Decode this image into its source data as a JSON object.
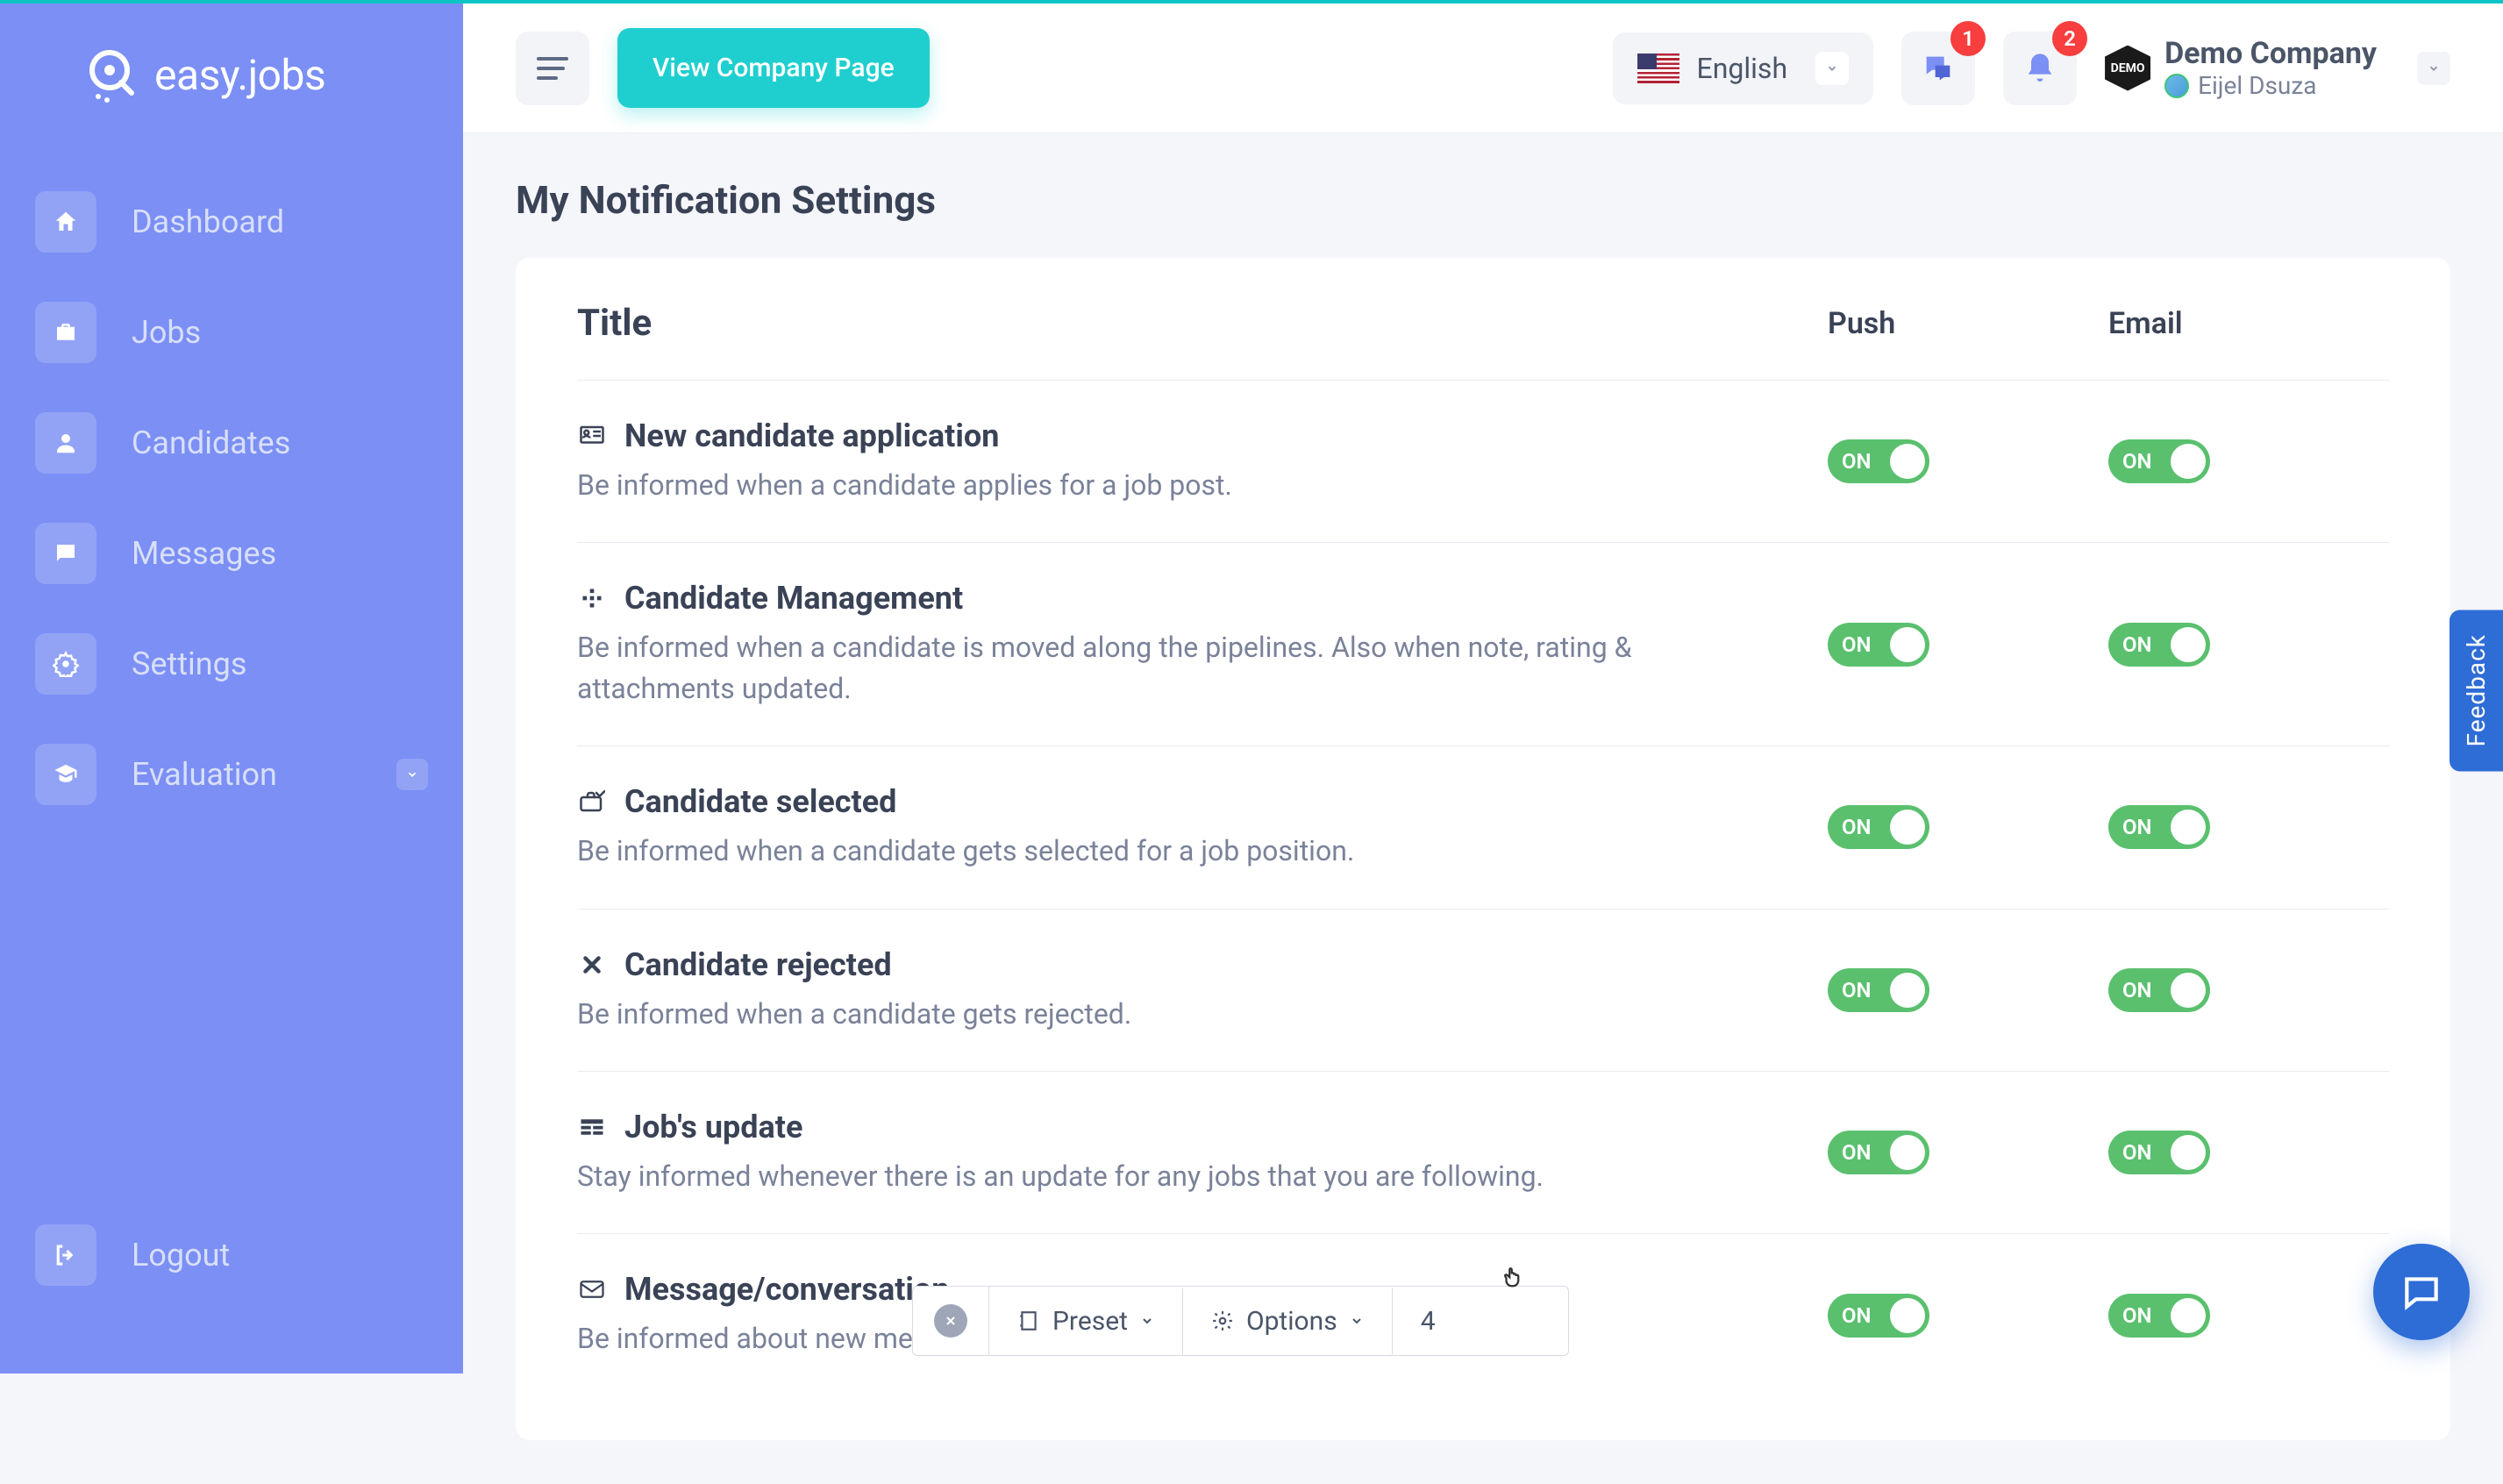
{
  "brand": {
    "name": "easy.jobs"
  },
  "sidebar": {
    "items": [
      {
        "label": "Dashboard",
        "icon": "home-icon"
      },
      {
        "label": "Jobs",
        "icon": "briefcase-icon"
      },
      {
        "label": "Candidates",
        "icon": "user-icon"
      },
      {
        "label": "Messages",
        "icon": "chat-icon"
      },
      {
        "label": "Settings",
        "icon": "gear-icon"
      },
      {
        "label": "Evaluation",
        "icon": "graduation-icon",
        "has_chevron": true
      }
    ],
    "logout_label": "Logout"
  },
  "topbar": {
    "view_company_label": "View Company Page",
    "language": "English",
    "messages_badge": "1",
    "notifications_badge": "2",
    "company_name": "Demo Company",
    "company_badge": "DEMO",
    "user_name": "Eijel Dsuza"
  },
  "page": {
    "title": "My Notification Settings",
    "col_title": "Title",
    "col_push": "Push",
    "col_email": "Email"
  },
  "notifications": [
    {
      "icon": "application-icon",
      "title": "New candidate application",
      "desc": "Be informed when a candidate applies for a job post.",
      "push": "ON",
      "email": "ON"
    },
    {
      "icon": "management-icon",
      "title": "Candidate Management",
      "desc": "Be informed when a candidate is moved along the pipelines. Also when note, rating & attachments updated.",
      "push": "ON",
      "email": "ON"
    },
    {
      "icon": "selected-icon",
      "title": "Candidate selected",
      "desc": "Be informed when a candidate gets selected for a job position.",
      "push": "ON",
      "email": "ON"
    },
    {
      "icon": "rejected-icon",
      "title": "Candidate rejected",
      "desc": "Be informed when a candidate gets rejected.",
      "push": "ON",
      "email": "ON"
    },
    {
      "icon": "job-update-icon",
      "title": "Job's update",
      "desc": "Stay informed whenever there is an update for any jobs that you are following.",
      "push": "ON",
      "email": "ON"
    },
    {
      "icon": "message-icon",
      "title": "Message/conversation",
      "desc": "Be informed about new messages/conversations.",
      "push": "ON",
      "email": "ON"
    }
  ],
  "feedback": {
    "label": "Feedback"
  },
  "toolbar": {
    "preset_label": "Preset",
    "options_label": "Options",
    "page": "4"
  }
}
